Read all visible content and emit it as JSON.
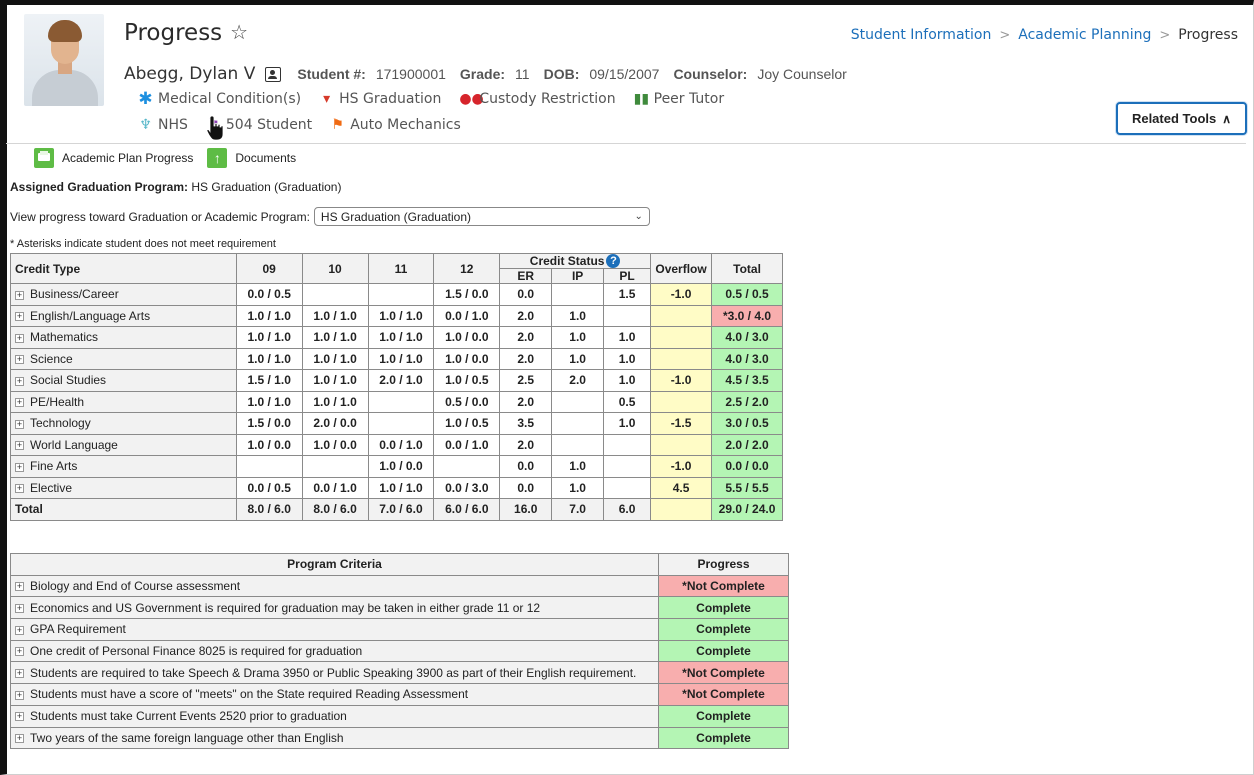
{
  "page": {
    "title": "Progress"
  },
  "breadcrumb": [
    "Student Information",
    "Academic Planning",
    "Progress"
  ],
  "student": {
    "name": "Abegg, Dylan V",
    "number_label": "Student #:",
    "number": "171900001",
    "grade_label": "Grade:",
    "grade": "11",
    "dob_label": "DOB:",
    "dob": "09/15/2007",
    "counselor_label": "Counselor:",
    "counselor": "Joy Counselor"
  },
  "flags_row1": [
    {
      "label": "Medical Condition(s)",
      "icon": "asterisk-icon",
      "color": "#1c8fe0"
    },
    {
      "label": "HS Graduation",
      "icon": "graduation-icon",
      "color": "#d63a2a"
    },
    {
      "label": "Custody Restriction",
      "icon": "people-icon",
      "color": "#d6242b"
    },
    {
      "label": "Peer Tutor",
      "icon": "book-icon",
      "color": "#3f8a3c"
    }
  ],
  "flags_row2": [
    {
      "label": "NHS",
      "icon": "trophy-icon",
      "color": "#57b7c9"
    },
    {
      "label": "504 Student",
      "icon": "flag-icon",
      "color": "#8a3fb0"
    },
    {
      "label": "Auto Mechanics",
      "icon": "flag-icon",
      "color": "#f06a12"
    }
  ],
  "related_tools": "Related Tools",
  "toolbar": {
    "print_label": "Academic Plan Progress",
    "documents_label": "Documents"
  },
  "assigned": {
    "label": "Assigned Graduation Program:",
    "value": "HS Graduation (Graduation)"
  },
  "view_progress": {
    "label": "View progress toward Graduation or Academic Program:",
    "selected": "HS Graduation (Graduation)"
  },
  "asterisk_note": "* Asterisks indicate student does not meet requirement",
  "credit_table": {
    "headers": {
      "credit_type": "Credit Type",
      "g09": "09",
      "g10": "10",
      "g11": "11",
      "g12": "12",
      "credit_status": "Credit Status",
      "er": "ER",
      "ip": "IP",
      "pl": "PL",
      "overflow": "Overflow",
      "total": "Total"
    },
    "rows": [
      {
        "type": "Business/Career",
        "g09": "0.0 / 0.5",
        "g10": "",
        "g11": "",
        "g12": "1.5 / 0.0",
        "er": "0.0",
        "ip": "",
        "pl": "1.5",
        "overflow": "-1.0",
        "total": "0.5 / 0.5",
        "met": true
      },
      {
        "type": "English/Language Arts",
        "g09": "1.0 / 1.0",
        "g10": "1.0 / 1.0",
        "g11": "1.0 / 1.0",
        "g12": "0.0 / 1.0",
        "er": "2.0",
        "ip": "1.0",
        "pl": "",
        "overflow": "",
        "total": "*3.0 / 4.0",
        "met": false
      },
      {
        "type": "Mathematics",
        "g09": "1.0 / 1.0",
        "g10": "1.0 / 1.0",
        "g11": "1.0 / 1.0",
        "g12": "1.0 / 0.0",
        "er": "2.0",
        "ip": "1.0",
        "pl": "1.0",
        "overflow": "",
        "total": "4.0 / 3.0",
        "met": true
      },
      {
        "type": "Science",
        "g09": "1.0 / 1.0",
        "g10": "1.0 / 1.0",
        "g11": "1.0 / 1.0",
        "g12": "1.0 / 0.0",
        "er": "2.0",
        "ip": "1.0",
        "pl": "1.0",
        "overflow": "",
        "total": "4.0 / 3.0",
        "met": true
      },
      {
        "type": "Social Studies",
        "g09": "1.5 / 1.0",
        "g10": "1.0 / 1.0",
        "g11": "2.0 / 1.0",
        "g12": "1.0 / 0.5",
        "er": "2.5",
        "ip": "2.0",
        "pl": "1.0",
        "overflow": "-1.0",
        "total": "4.5 / 3.5",
        "met": true
      },
      {
        "type": "PE/Health",
        "g09": "1.0 / 1.0",
        "g10": "1.0 / 1.0",
        "g11": "",
        "g12": "0.5 / 0.0",
        "er": "2.0",
        "ip": "",
        "pl": "0.5",
        "overflow": "",
        "total": "2.5 / 2.0",
        "met": true
      },
      {
        "type": "Technology",
        "g09": "1.5 / 0.0",
        "g10": "2.0 / 0.0",
        "g11": "",
        "g12": "1.0 / 0.5",
        "er": "3.5",
        "ip": "",
        "pl": "1.0",
        "overflow": "-1.5",
        "total": "3.0 / 0.5",
        "met": true
      },
      {
        "type": "World Language",
        "g09": "1.0 / 0.0",
        "g10": "1.0 / 0.0",
        "g11": "0.0 / 1.0",
        "g12": "0.0 / 1.0",
        "er": "2.0",
        "ip": "",
        "pl": "",
        "overflow": "",
        "total": "2.0 / 2.0",
        "met": true
      },
      {
        "type": "Fine Arts",
        "g09": "",
        "g10": "",
        "g11": "1.0 / 0.0",
        "g12": "",
        "er": "0.0",
        "ip": "1.0",
        "pl": "",
        "overflow": "-1.0",
        "total": "0.0 / 0.0",
        "met": true
      },
      {
        "type": "Elective",
        "g09": "0.0 / 0.5",
        "g10": "0.0 / 1.0",
        "g11": "1.0 / 1.0",
        "g12": "0.0 / 3.0",
        "er": "0.0",
        "ip": "1.0",
        "pl": "",
        "overflow": "4.5",
        "total": "5.5 / 5.5",
        "met": true
      }
    ],
    "total_row": {
      "type": "Total",
      "g09": "8.0 / 6.0",
      "g10": "8.0 / 6.0",
      "g11": "7.0 / 6.0",
      "g12": "6.0 / 6.0",
      "er": "16.0",
      "ip": "7.0",
      "pl": "6.0",
      "overflow": "",
      "total": "29.0 / 24.0"
    }
  },
  "criteria_table": {
    "headers": {
      "criteria": "Program Criteria",
      "progress": "Progress"
    },
    "rows": [
      {
        "criteria": "Biology and End of Course assessment",
        "progress": "*Not Complete",
        "complete": false
      },
      {
        "criteria": "Economics and US Government is required for graduation may be taken in either grade 11 or 12",
        "progress": "Complete",
        "complete": true
      },
      {
        "criteria": "GPA Requirement",
        "progress": "Complete",
        "complete": true
      },
      {
        "criteria": "One credit of Personal Finance 8025 is required for graduation",
        "progress": "Complete",
        "complete": true
      },
      {
        "criteria": "Students are required to take Speech & Drama 3950 or Public Speaking 3900 as part of their English requirement.",
        "progress": "*Not Complete",
        "complete": false
      },
      {
        "criteria": "Students must have a score of \"meets\" on the State required Reading Assessment",
        "progress": "*Not Complete",
        "complete": false
      },
      {
        "criteria": "Students must take Current Events 2520 prior to graduation",
        "progress": "Complete",
        "complete": true
      },
      {
        "criteria": "Two years of the same foreign language other than English",
        "progress": "Complete",
        "complete": true
      }
    ]
  }
}
